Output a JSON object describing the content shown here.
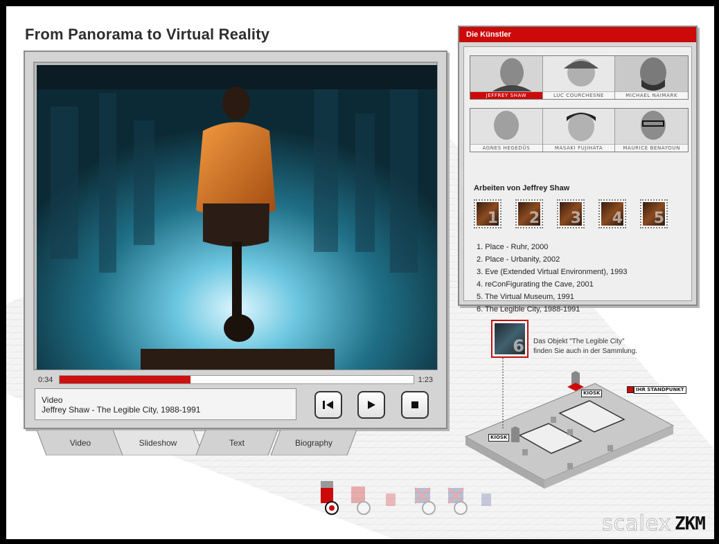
{
  "page": {
    "title": "From Panorama to Virtual Reality"
  },
  "player": {
    "time_elapsed": "0:34",
    "time_total": "1:23",
    "progress_fraction": 0.37,
    "media_type": "Video",
    "media_caption": "Jeffrey Shaw - The Legible City, 1988-1991",
    "controls": {
      "rewind": "rewind-icon",
      "play": "play-icon",
      "stop": "stop-icon"
    }
  },
  "tabs": [
    {
      "label": "Video"
    },
    {
      "label": "Slideshow"
    },
    {
      "label": "Text"
    },
    {
      "label": "Biography"
    }
  ],
  "artists_panel": {
    "header": "Die Künstler",
    "artists_row1": [
      "JEFFREY SHAW",
      "LUC COURCHESNE",
      "MICHAEL NAIMARK"
    ],
    "artists_row2": [
      "AGNES HEGEDÜS",
      "MASAKI FUJIHATA",
      "MAURICE BENAYOUN"
    ],
    "works_title": "Arbeiten von Jeffrey Shaw",
    "work_numbers": [
      "1",
      "2",
      "3",
      "4",
      "5"
    ],
    "works": [
      "1. Place - Ruhr, 2000",
      "2. Place - Urbanity, 2002",
      "3. Eve (Extended Virtual Environment), 1993",
      "4. reConFigurating the Cave, 2001",
      "5. The Virtual Museum, 1991",
      "6. The Legible City, 1988-1991"
    ]
  },
  "map": {
    "object_number": "6",
    "object_text_line1": "Das Objekt \"The Legible City\"",
    "object_text_line2": "finden Sie auch in der Sammlung.",
    "kiosk_label": "KIOSK",
    "standort_label": "IHR STANDPUNKT",
    "accent": "#cc0a0a"
  },
  "branding": {
    "logo1": "scalex",
    "logo2": "ZKM"
  }
}
